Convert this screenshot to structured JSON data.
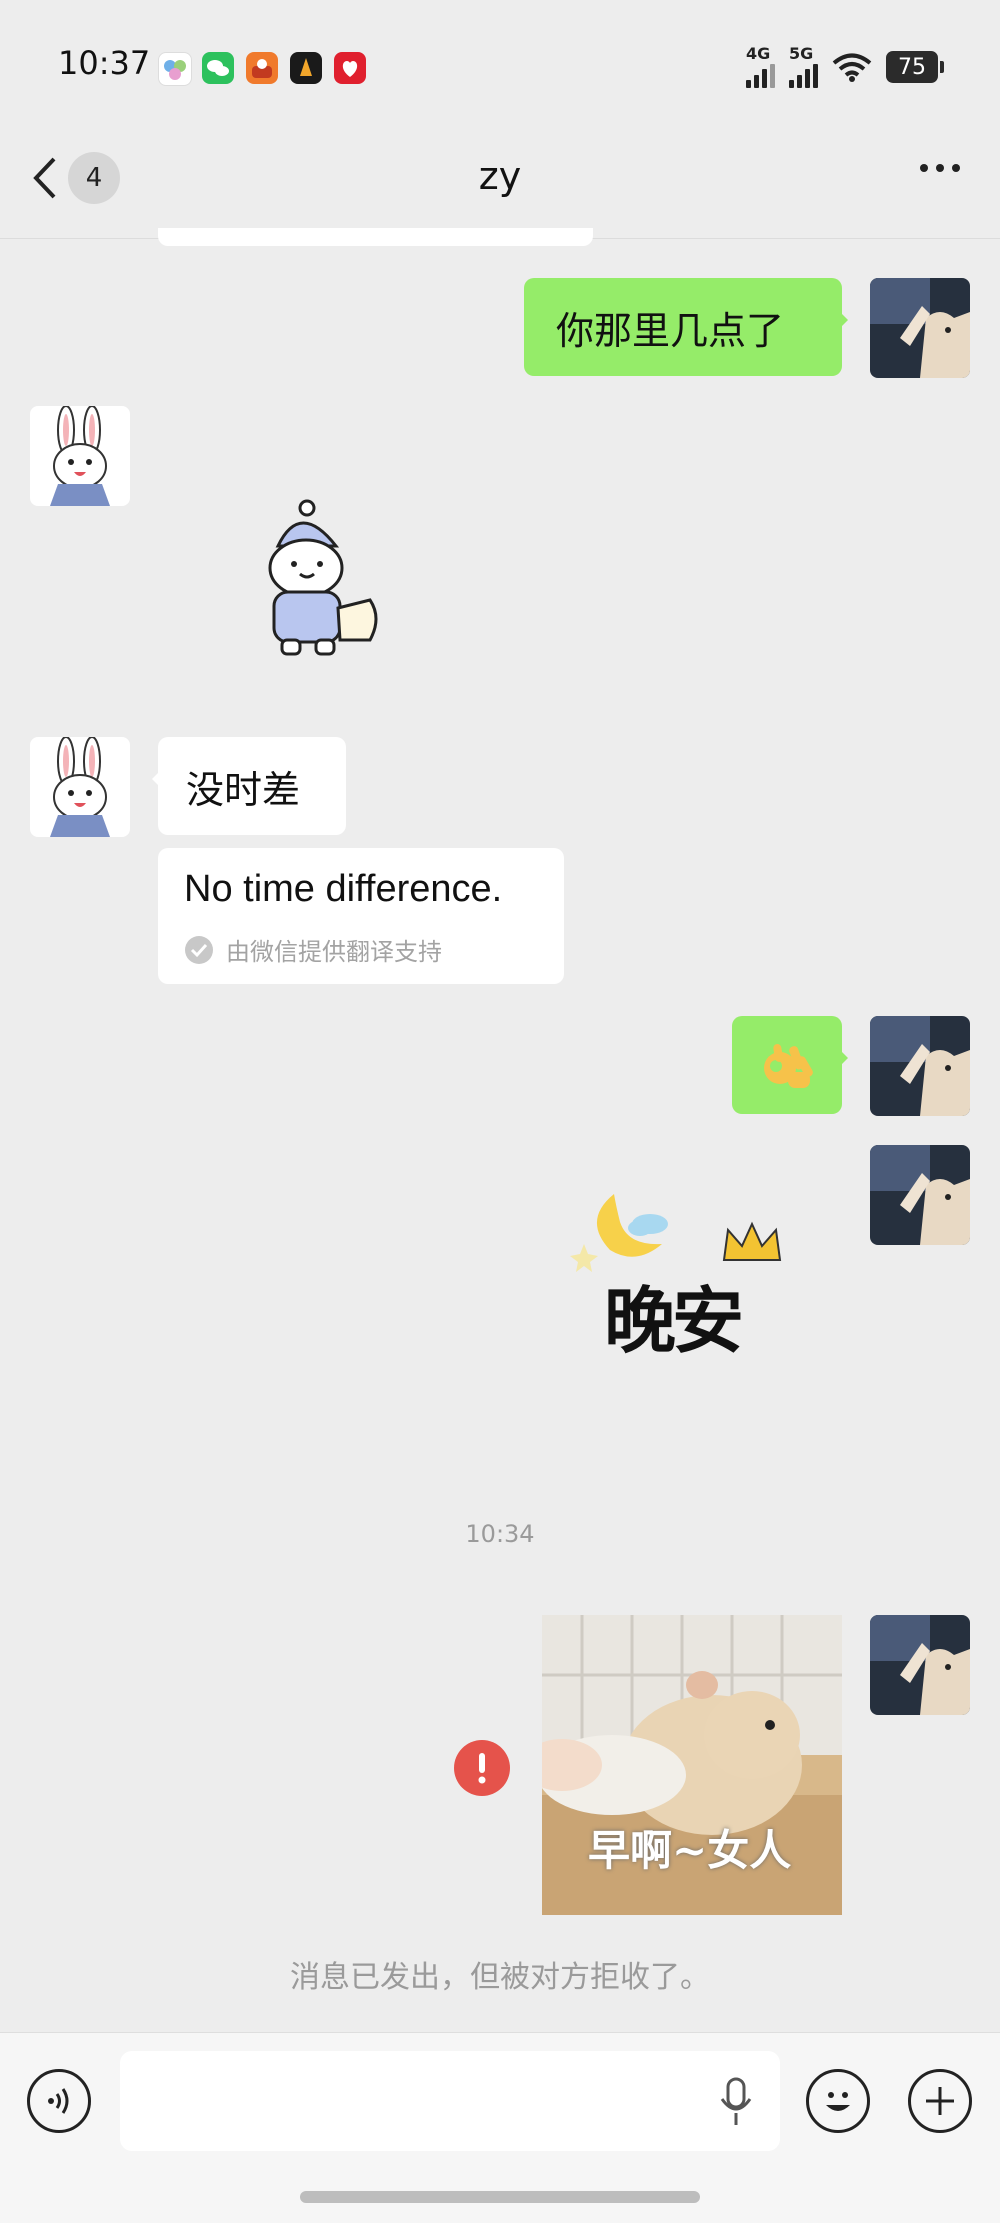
{
  "status_bar": {
    "time": "10:37",
    "network_1": "4G",
    "network_2": "5G",
    "battery": "75"
  },
  "header": {
    "back_badge": "4",
    "title": "zy"
  },
  "messages": {
    "me_1": "你那里几点了",
    "other_1": "没时差",
    "translation": "No time difference.",
    "translation_provider": "由微信提供翻译支持",
    "sticker_goodnight": "晚安",
    "timestamp": "10:34",
    "sticker_hamster_caption": "早啊~女人",
    "rejected_notice": "消息已发出，但被对方拒收了。"
  },
  "colors": {
    "my_bubble": "#95ec69",
    "error": "#e5534b"
  }
}
